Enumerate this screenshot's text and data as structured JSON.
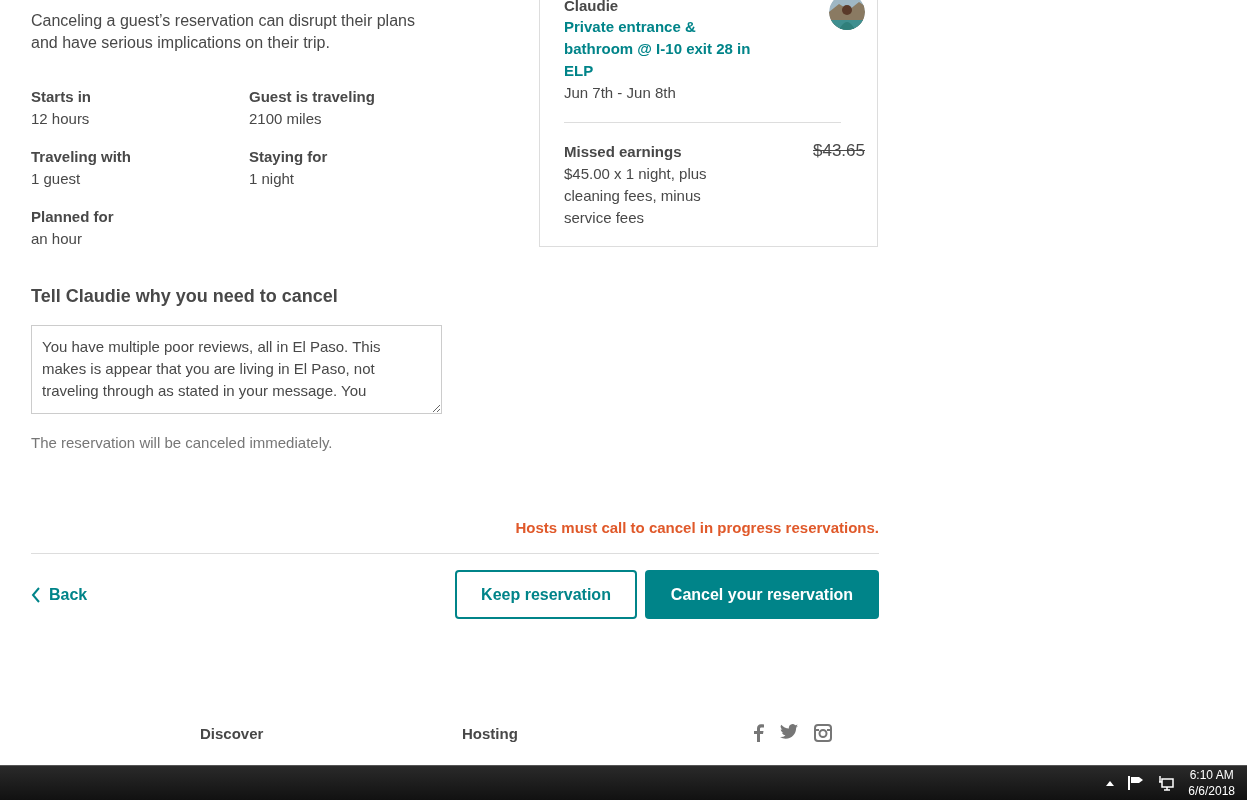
{
  "intro": "Canceling a guest’s reservation can disrupt their plans and have serious implications on their trip.",
  "facts": [
    {
      "label": "Starts in",
      "value": "12 hours"
    },
    {
      "label": "Guest is traveling",
      "value": "2100 miles"
    },
    {
      "label": "Traveling with",
      "value": "1 guest"
    },
    {
      "label": "Staying for",
      "value": "1 night"
    },
    {
      "label": "Planned for",
      "value": "an hour"
    }
  ],
  "reason": {
    "heading": "Tell Claudie why you need to cancel",
    "value": "You have multiple poor reviews, all in El Paso. This makes is appear that you are living in El Paso, not traveling through as stated in your message. You",
    "note": "The reservation will be canceled immediately."
  },
  "summary": {
    "guest": "Claudie",
    "listing": "Private entrance & bathroom @ I-10 exit 28 in ELP",
    "dates": "Jun 7th - Jun 8th",
    "earnings_label": "Missed earnings",
    "earnings_detail": "$45.00 x 1 night, plus cleaning fees, minus service fees",
    "amount": "$43.65"
  },
  "warning": "Hosts must call to cancel in progress reservations.",
  "actions": {
    "back": "Back",
    "keep": "Keep reservation",
    "cancel": "Cancel your reservation"
  },
  "footer": {
    "columns": [
      "Discover",
      "Hosting"
    ]
  },
  "taskbar": {
    "time": "6:10 AM",
    "date": "6/6/2018"
  }
}
